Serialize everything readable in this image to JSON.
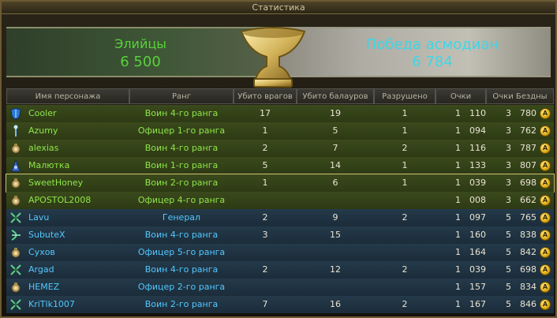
{
  "window": {
    "title": "Статистика"
  },
  "factions": {
    "left": {
      "name": "Элийцы",
      "score": "6 500"
    },
    "right": {
      "name": "Победа асмодиан",
      "score": "6 784"
    }
  },
  "columns": [
    "Имя персонажа",
    "Ранг",
    "Убито врагов",
    "Убито балауров",
    "Разрушено",
    "Очки",
    "Очки Бездны"
  ],
  "rows": [
    {
      "faction": "elyos",
      "icon": "shield-icon",
      "name": "Cooler",
      "rank": "Воин 4-го ранга",
      "kills": "17",
      "balaur": "19",
      "destroyed": "1",
      "points_a": "1",
      "points_b": "110",
      "abyss_a": "3",
      "abyss_b": "780"
    },
    {
      "faction": "elyos",
      "icon": "staff-icon",
      "name": "Azumy",
      "rank": "Офицер 1-го ранга",
      "kills": "1",
      "balaur": "5",
      "destroyed": "1",
      "points_a": "1",
      "points_b": "094",
      "abyss_a": "3",
      "abyss_b": "762"
    },
    {
      "faction": "elyos",
      "icon": "bag-icon",
      "name": "alexias",
      "rank": "Воин 4-го ранга",
      "kills": "2",
      "balaur": "7",
      "destroyed": "2",
      "points_a": "1",
      "points_b": "116",
      "abyss_a": "3",
      "abyss_b": "787"
    },
    {
      "faction": "elyos",
      "icon": "wizard-icon",
      "name": "Малютка",
      "rank": "Воин 1-го ранга",
      "kills": "5",
      "balaur": "14",
      "destroyed": "1",
      "points_a": "1",
      "points_b": "133",
      "abyss_a": "3",
      "abyss_b": "807"
    },
    {
      "faction": "elyos",
      "icon": "bag-icon",
      "name": "SweetHoney",
      "rank": "Воин 2-го ранга",
      "kills": "1",
      "balaur": "6",
      "destroyed": "1",
      "points_a": "1",
      "points_b": "039",
      "abyss_a": "3",
      "abyss_b": "698",
      "selected": true
    },
    {
      "faction": "elyos",
      "icon": "bag-icon",
      "name": "APOSTOL2008",
      "rank": "Офицер 4-го ранга",
      "kills": "",
      "balaur": "",
      "destroyed": "",
      "points_a": "1",
      "points_b": "008",
      "abyss_a": "3",
      "abyss_b": "662"
    },
    {
      "faction": "asmo",
      "icon": "swords-icon",
      "name": "Lavu",
      "rank": "Генерал",
      "kills": "2",
      "balaur": "9",
      "destroyed": "2",
      "points_a": "1",
      "points_b": "097",
      "abyss_a": "5",
      "abyss_b": "765"
    },
    {
      "faction": "asmo",
      "icon": "bow-icon",
      "name": "SubuteX",
      "rank": "Воин 4-го ранга",
      "kills": "3",
      "balaur": "15",
      "destroyed": "",
      "points_a": "1",
      "points_b": "160",
      "abyss_a": "5",
      "abyss_b": "838"
    },
    {
      "faction": "asmo",
      "icon": "bag-icon",
      "name": "Сухов",
      "rank": "Офицер 5-го ранга",
      "kills": "",
      "balaur": "",
      "destroyed": "",
      "points_a": "1",
      "points_b": "164",
      "abyss_a": "5",
      "abyss_b": "842"
    },
    {
      "faction": "asmo",
      "icon": "swords-icon",
      "name": "Argad",
      "rank": "Воин 4-го ранга",
      "kills": "2",
      "balaur": "12",
      "destroyed": "2",
      "points_a": "1",
      "points_b": "039",
      "abyss_a": "5",
      "abyss_b": "698"
    },
    {
      "faction": "asmo",
      "icon": "bag-icon",
      "name": "HEMEZ",
      "rank": "Офицер 2-го ранга",
      "kills": "",
      "balaur": "",
      "destroyed": "",
      "points_a": "1",
      "points_b": "157",
      "abyss_a": "5",
      "abyss_b": "834"
    },
    {
      "faction": "asmo",
      "icon": "swords-icon",
      "name": "KriTlk1007",
      "rank": "Воин 2-го ранга",
      "kills": "7",
      "balaur": "16",
      "destroyed": "2",
      "points_a": "1",
      "points_b": "167",
      "abyss_a": "5",
      "abyss_b": "846"
    }
  ],
  "colors": {
    "elyos_text": "#8fe64a",
    "asmo_text": "#52c8ff"
  },
  "abyss_coin_label": "A"
}
